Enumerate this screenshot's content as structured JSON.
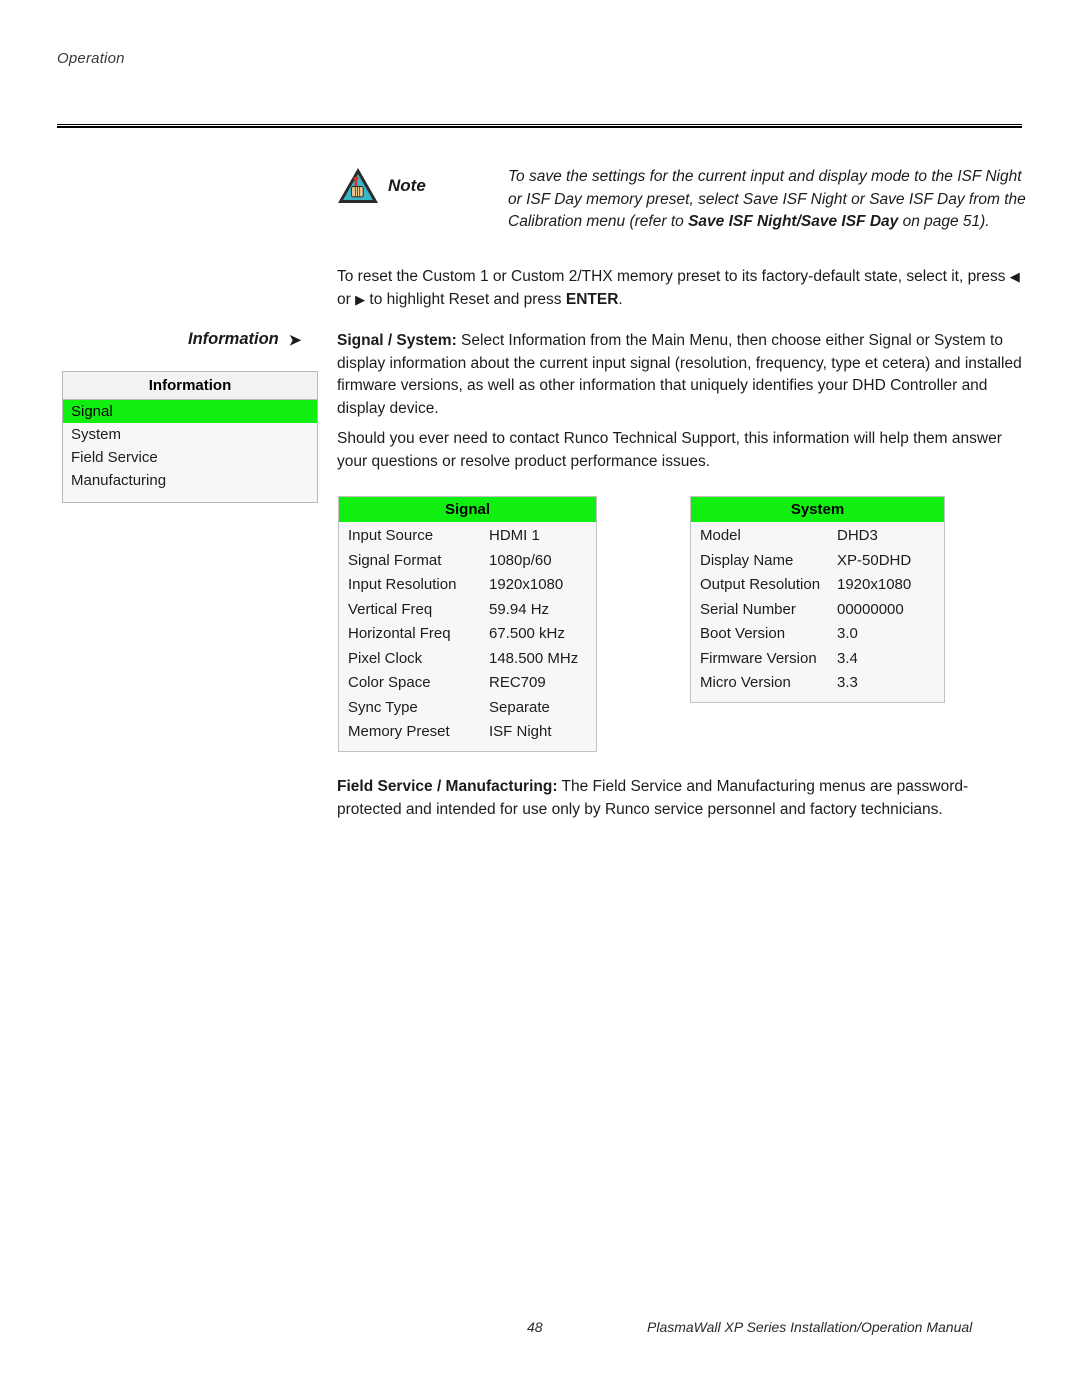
{
  "header": {
    "section": "Operation"
  },
  "note": {
    "icon": "note-triangle-hand-icon",
    "label": "Note",
    "line1": "To save the settings for the current input and display mode to the",
    "line2": "ISF Night or ISF Day memory preset, select Save ISF Night or Save",
    "line3_prefix": "ISF Day from the Calibration menu (refer to ",
    "line3_bold": "Save ISF Night/Save",
    "line4_bold": "ISF Day",
    "line4_suffix": " on page 51)."
  },
  "paragraphs": {
    "reset_part1": "To reset the Custom 1 or Custom 2/THX memory preset to its factory-default state, select it, press ",
    "reset_part2": " or ",
    "reset_part3": " to highlight Reset and press ",
    "reset_bold": "ENTER",
    "reset_end": ".",
    "signal_system_bold": "Signal / System:",
    "signal_system_text": " Select Information from the Main Menu, then choose either Signal or System to display information about the current input signal (resolution, frequency, type et cetera) and installed firmware versions, as well as other information that uniquely identifies your DHD Controller and display device.",
    "support_text": "Should you ever need to contact Runco Technical Support, this information will help them answer your questions or resolve product performance issues.",
    "field_service_bold": "Field Service / Manufacturing:",
    "field_service_text": " The Field Service and Manufacturing menus are password-protected and intended for use only by Runco service personnel and factory technicians."
  },
  "callout": {
    "label": "Information",
    "arrow_icon": "arrow-right-icon",
    "arrow_glyph": "➤"
  },
  "osd_menu": {
    "title": "Information",
    "items": [
      {
        "label": "Signal",
        "selected": true
      },
      {
        "label": "System",
        "selected": false
      },
      {
        "label": "Field Service",
        "selected": false
      },
      {
        "label": "Manufacturing",
        "selected": false
      }
    ]
  },
  "tables": {
    "signal": {
      "title": "Signal",
      "rows": [
        {
          "key": "Input Source",
          "value": "HDMI 1"
        },
        {
          "key": "Signal Format",
          "value": "1080p/60"
        },
        {
          "key": "Input Resolution",
          "value": "1920x1080"
        },
        {
          "key": "Vertical Freq",
          "value": "59.94 Hz"
        },
        {
          "key": "Horizontal Freq",
          "value": "67.500 kHz"
        },
        {
          "key": "Pixel Clock",
          "value": "148.500 MHz"
        },
        {
          "key": "Color Space",
          "value": "REC709"
        },
        {
          "key": "Sync Type",
          "value": "Separate"
        },
        {
          "key": "Memory Preset",
          "value": "ISF Night"
        }
      ]
    },
    "system": {
      "title": "System",
      "rows": [
        {
          "key": "Model",
          "value": "DHD3"
        },
        {
          "key": "Display Name",
          "value": "XP-50DHD"
        },
        {
          "key": "Output Resolution",
          "value": "1920x1080"
        },
        {
          "key": "Serial Number",
          "value": "00000000"
        },
        {
          "key": "Boot Version",
          "value": "3.0"
        },
        {
          "key": "Firmware Version",
          "value": "3.4"
        },
        {
          "key": "Micro Version",
          "value": "3.3"
        }
      ]
    }
  },
  "footer": {
    "page_number": "48",
    "manual_title": "PlasmaWall XP Series Installation/Operation Manual"
  },
  "colors": {
    "osd_green": "#10ef10",
    "osd_panel": "#f7f7f7",
    "osd_border": "#c2c2c2",
    "note_icon_fill": "#35b7c8",
    "note_icon_outline": "#2b2b2b"
  }
}
